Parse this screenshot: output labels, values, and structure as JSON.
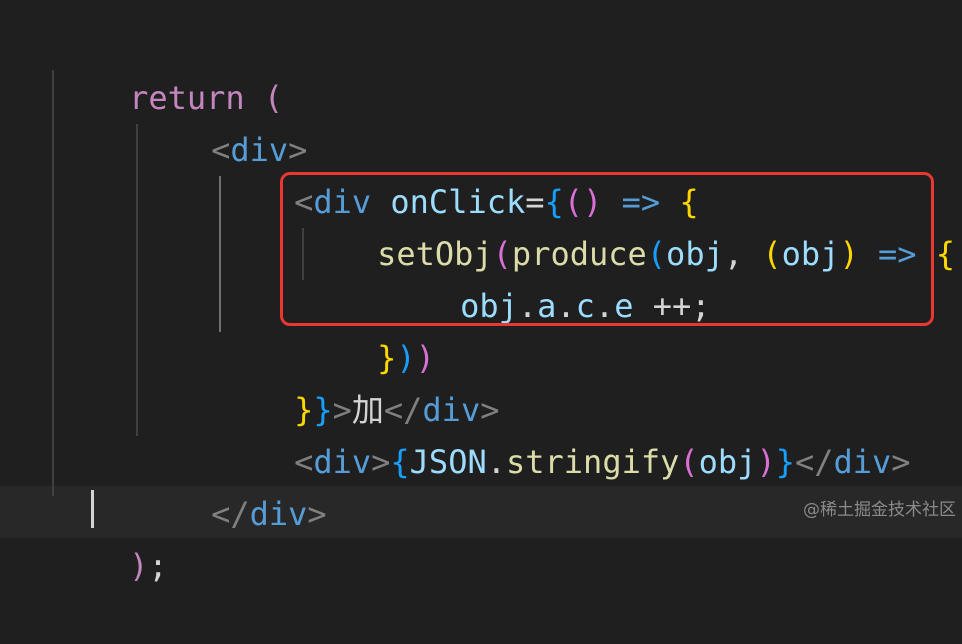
{
  "colors": {
    "background": "#1f1f1f",
    "keyword": "#c586c0",
    "tag_bracket": "#808080",
    "tag_name": "#569cd6",
    "variable": "#9cdcfe",
    "function": "#dcdcaa",
    "bracket_gold": "#ffd700",
    "bracket_magenta": "#da70d6",
    "bracket_blue": "#179fff",
    "arrow": "#569cd6",
    "text": "#d4d4d4",
    "highlight": "#e8382f"
  },
  "code": {
    "l1": {
      "t1": "return",
      "t2": " ("
    },
    "l2": {
      "t1": "<",
      "t2": "div",
      "t3": ">"
    },
    "l3": {
      "t1": "<",
      "t2": "div",
      "t3": " ",
      "t4": "onClick",
      "t5": "=",
      "t6": "{",
      "t7": "()",
      "t8": " => ",
      "t9": "{"
    },
    "l4": {
      "t1": "setObj",
      "t2": "(",
      "t3": "produce",
      "t4": "(",
      "t5": "obj",
      "t6": ", ",
      "t7": "(",
      "t8": "obj",
      "t9": ")",
      "t10": " => ",
      "t11": "{"
    },
    "l5": {
      "t1": "obj",
      "t2": ".",
      "t3": "a",
      "t4": ".",
      "t5": "c",
      "t6": ".",
      "t7": "e",
      "t8": " ++;"
    },
    "l6": {
      "t1": "}",
      "t2": ")",
      "t3": ")"
    },
    "l7": {
      "t1": "}",
      "t2": "}",
      "t3": ">",
      "t4": "加",
      "t5": "</",
      "t6": "div",
      "t7": ">"
    },
    "l8": {
      "t1": "<",
      "t2": "div",
      "t3": ">",
      "t4": "{",
      "t5": "JSON",
      "t6": ".",
      "t7": "stringify",
      "t8": "(",
      "t9": "obj",
      "t10": ")",
      "t11": "}",
      "t12": "</",
      "t13": "div",
      "t14": ">"
    },
    "l9": {
      "t1": "</",
      "t2": "div",
      "t3": ">"
    },
    "l10": {
      "t1": ")",
      "t2": ";"
    }
  },
  "watermark": "@稀土掘金技术社区"
}
